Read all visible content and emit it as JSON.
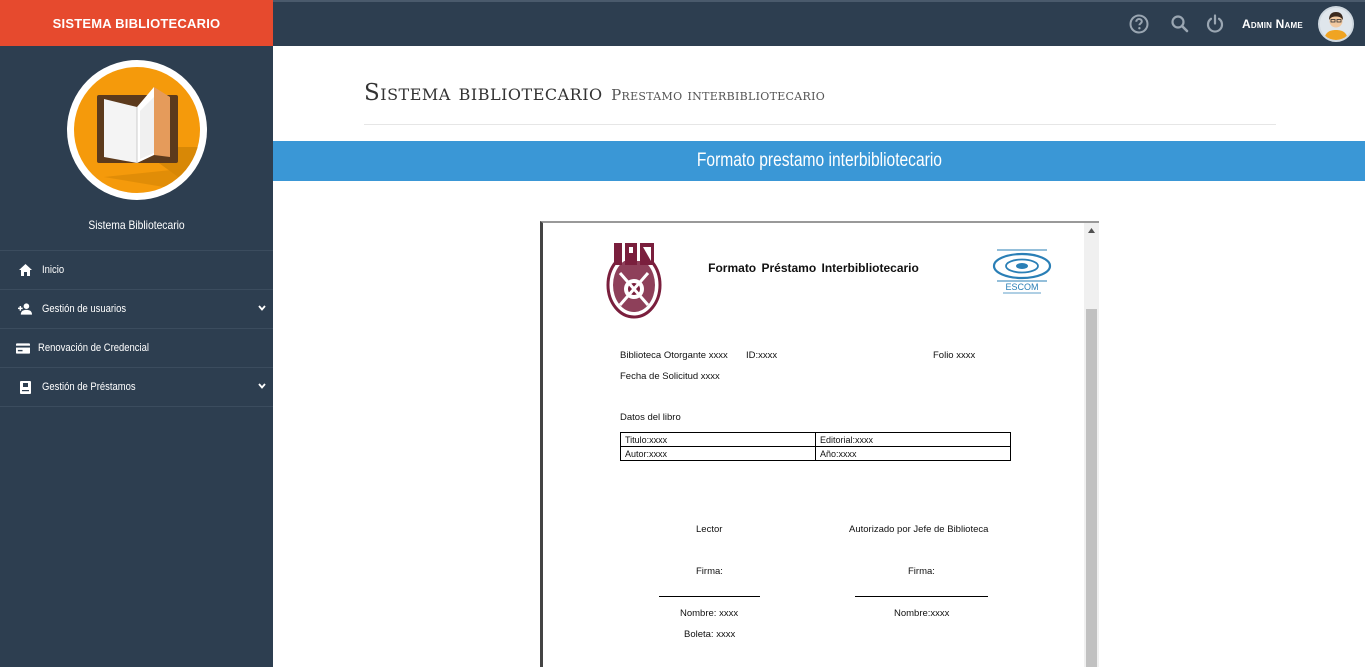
{
  "brand": {
    "title": "SISTEMA BIBLIOTECARIO"
  },
  "profile": {
    "name": "Sistema Bibliotecario",
    "icon": "open-book-icon"
  },
  "sidebar": {
    "items": [
      {
        "label": "Inicio",
        "icon": "home-icon",
        "has_submenu": false
      },
      {
        "label": "Gestión de usuarios",
        "icon": "add-user-icon",
        "has_submenu": true
      },
      {
        "label": "Renovación de Credencial",
        "icon": "credit-card-icon",
        "has_submenu": false
      },
      {
        "label": "Gestión de Préstamos",
        "icon": "book-icon",
        "has_submenu": true
      }
    ]
  },
  "topbar": {
    "icons": [
      "help-icon",
      "search-icon",
      "power-icon"
    ],
    "user_name": "Admin Name"
  },
  "header": {
    "title": "Sistema bibliotecario",
    "subtitle": "Prestamo interbibliotecario"
  },
  "banner": {
    "text": "Formato prestamo interbibliotecario"
  },
  "document": {
    "title": "Formato Préstamo Interbibliotecario",
    "escom_label": "ESCOM",
    "biblioteca": "Biblioteca Otorgante xxxx",
    "id": "ID:xxxx",
    "folio": "Folio xxxx",
    "fecha": "Fecha de Solicitud xxxx",
    "datos_libro": "Datos del libro",
    "table": [
      [
        "Titulo:xxxx",
        "Editorial:xxxx"
      ],
      [
        "Autor:xxxx",
        "Año:xxxx"
      ]
    ],
    "lector_heading": "Lector",
    "jefe_heading": "Autorizado por Jefe de Biblioteca",
    "firma_left": "Firma:",
    "firma_right": "Firma:",
    "nombre_left": "Nombre: xxxx",
    "nombre_right": "Nombre:xxxx",
    "boleta": "Boleta: xxxx"
  },
  "colors": {
    "sidebar_bg": "#2d3e50",
    "brand_bg": "#e64a2e",
    "banner_bg": "#3a97d6",
    "avatar_bg": "#f59a0b",
    "ipn_color": "#7a1f3d"
  }
}
